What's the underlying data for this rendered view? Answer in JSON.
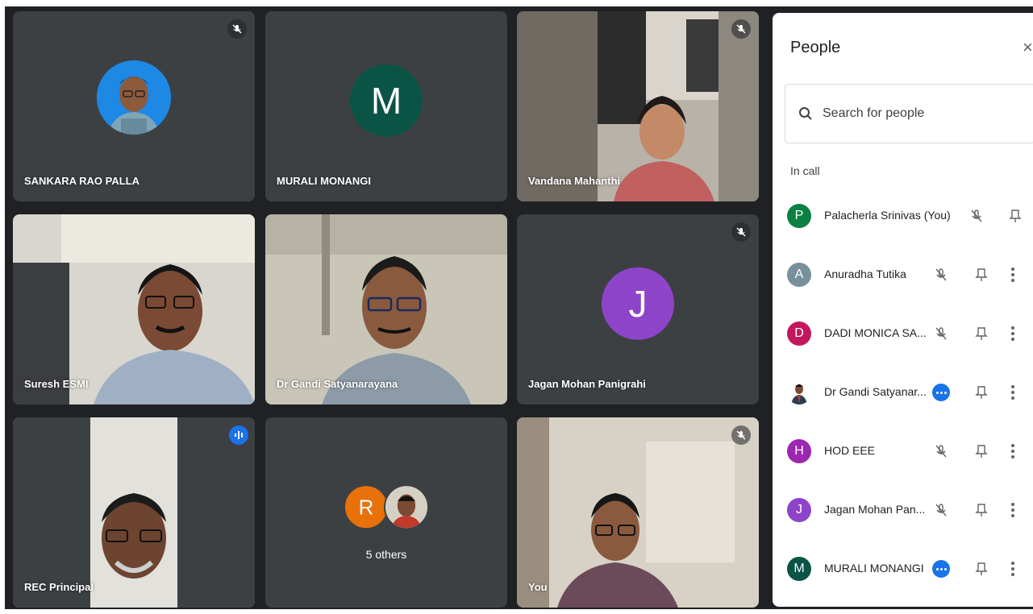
{
  "tiles": [
    {
      "name": "SANKARA RAO PALLA",
      "muted": true
    },
    {
      "name": "MURALI MONANGI",
      "initial": "M",
      "color": "#0b5345"
    },
    {
      "name": "Vandana Mahanthi",
      "muted": true
    },
    {
      "name": "Suresh ESMI"
    },
    {
      "name": "Dr Gandi Satyanarayana"
    },
    {
      "name": "Jagan Mohan Panigrahi",
      "initial": "J",
      "color": "#8e44c9",
      "muted": true
    },
    {
      "name": "REC Principal",
      "speaking": true
    },
    {
      "name": "5 others",
      "initial": "R",
      "color": "#e8710a"
    },
    {
      "name": "You",
      "muted": true
    }
  ],
  "panel": {
    "title": "People",
    "close_icon": "×",
    "search_placeholder": "Search for people",
    "section_label": "In call",
    "participants": [
      {
        "initial": "P",
        "name": "Palacherla Srinivas (You)",
        "color": "#0b8043"
      },
      {
        "initial": "A",
        "name": "Anuradha Tutika",
        "color": "#78909c"
      },
      {
        "initial": "D",
        "name": "DADI MONICA SA...",
        "color": "#c2185b"
      },
      {
        "initial": "",
        "name": "Dr Gandi Satyanar...",
        "color": "#ffffff"
      },
      {
        "initial": "H",
        "name": "HOD EEE",
        "color": "#9c27b0"
      },
      {
        "initial": "J",
        "name": "Jagan Mohan Pan...",
        "color": "#8e44c9"
      },
      {
        "initial": "M",
        "name": "MURALI MONANGI",
        "color": "#0b5345"
      }
    ]
  }
}
